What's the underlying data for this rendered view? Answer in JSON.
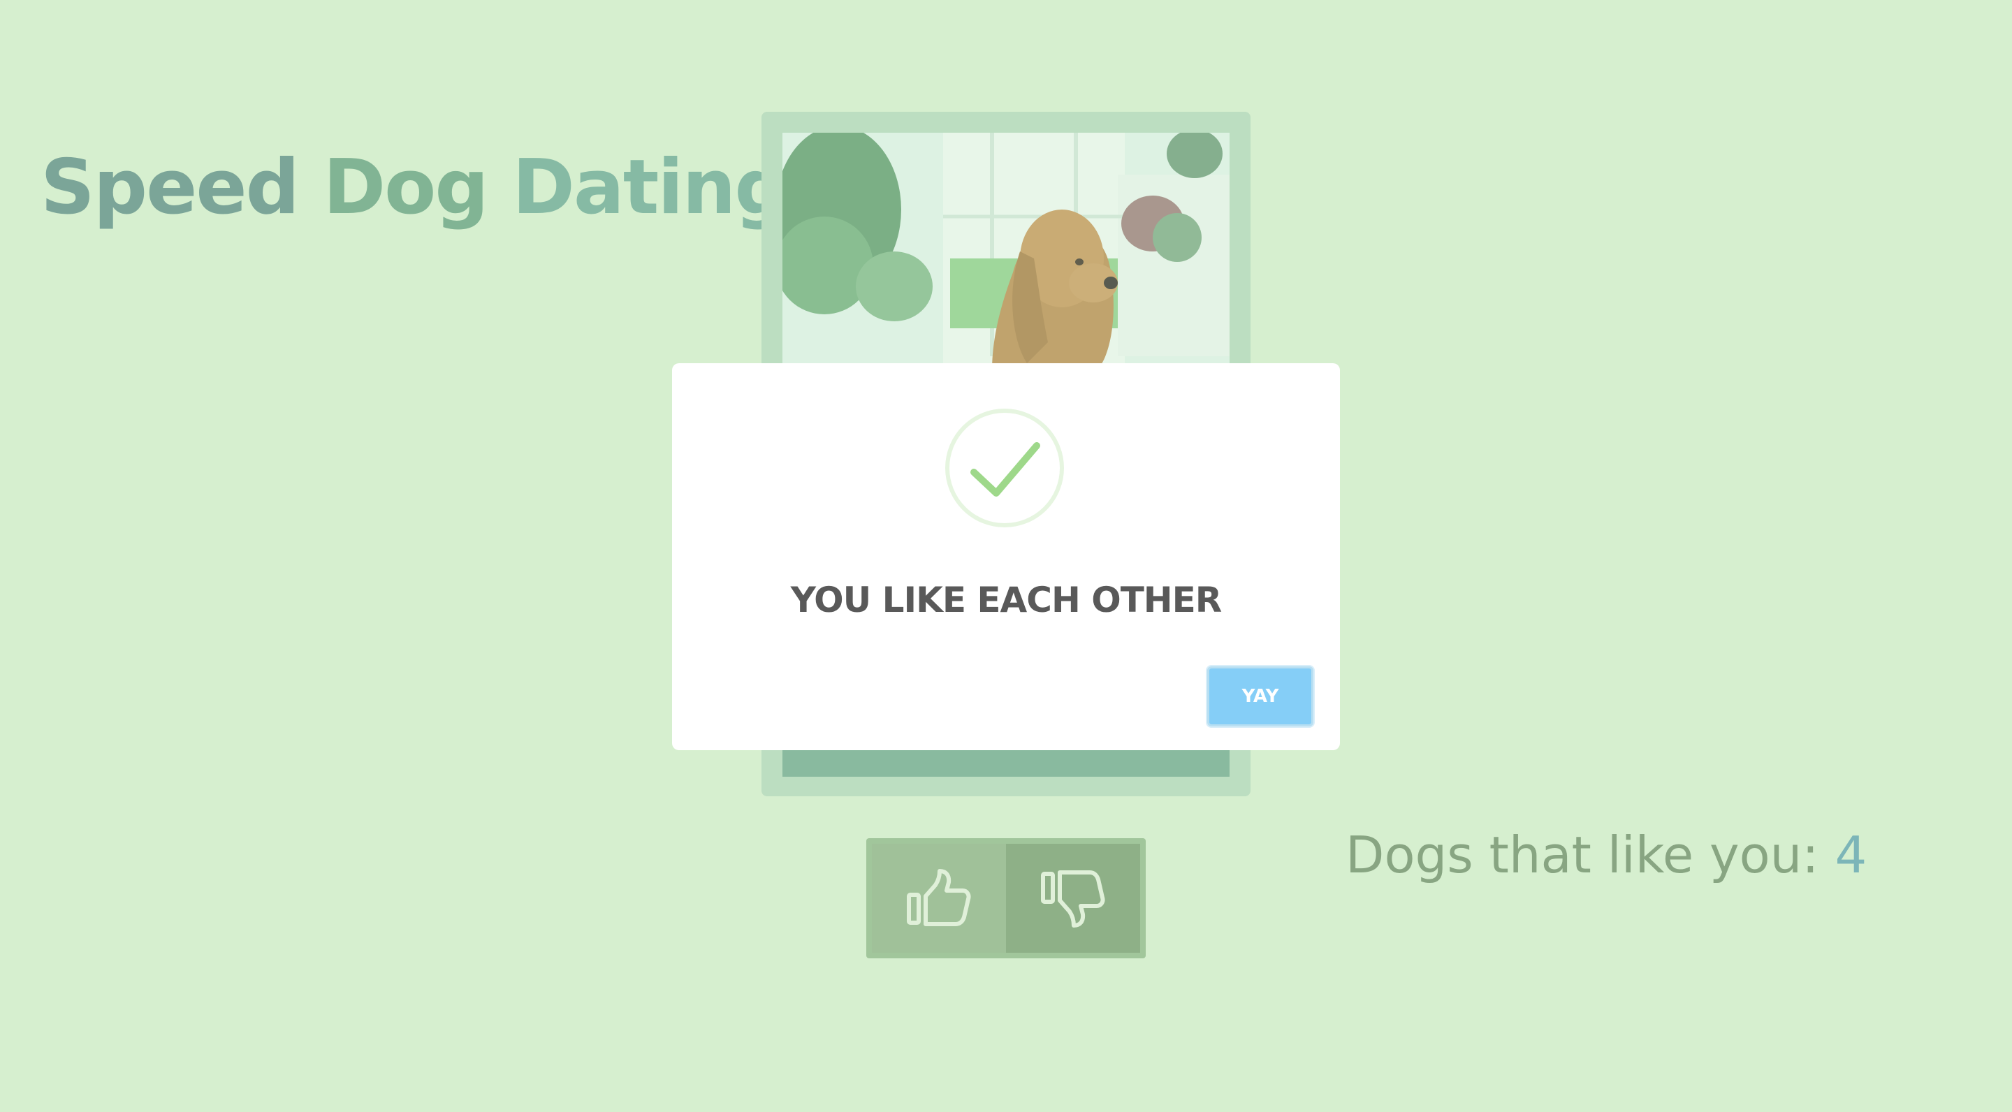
{
  "app": {
    "title_words": [
      "Speed",
      "Dog",
      "Dating"
    ],
    "colors": {
      "background": "#d6efcf",
      "title_word_1": "#5c8c86",
      "title_word_2": "#64a080",
      "title_word_3": "#6ba896",
      "accent": "#5ea2b0"
    }
  },
  "card": {
    "photo_alt": "Golden retriever photo",
    "photo_icon": "dog-photo"
  },
  "actions": {
    "like_icon": "thumbs-up-icon",
    "dislike_icon": "thumbs-down-icon"
  },
  "counter": {
    "label": "Dogs that like you: ",
    "value": "4"
  },
  "modal": {
    "icon": "checkmark-icon",
    "title": "YOU LIKE EACH OTHER",
    "confirm_label": "YAY",
    "confirm_color": "#85cef7"
  }
}
